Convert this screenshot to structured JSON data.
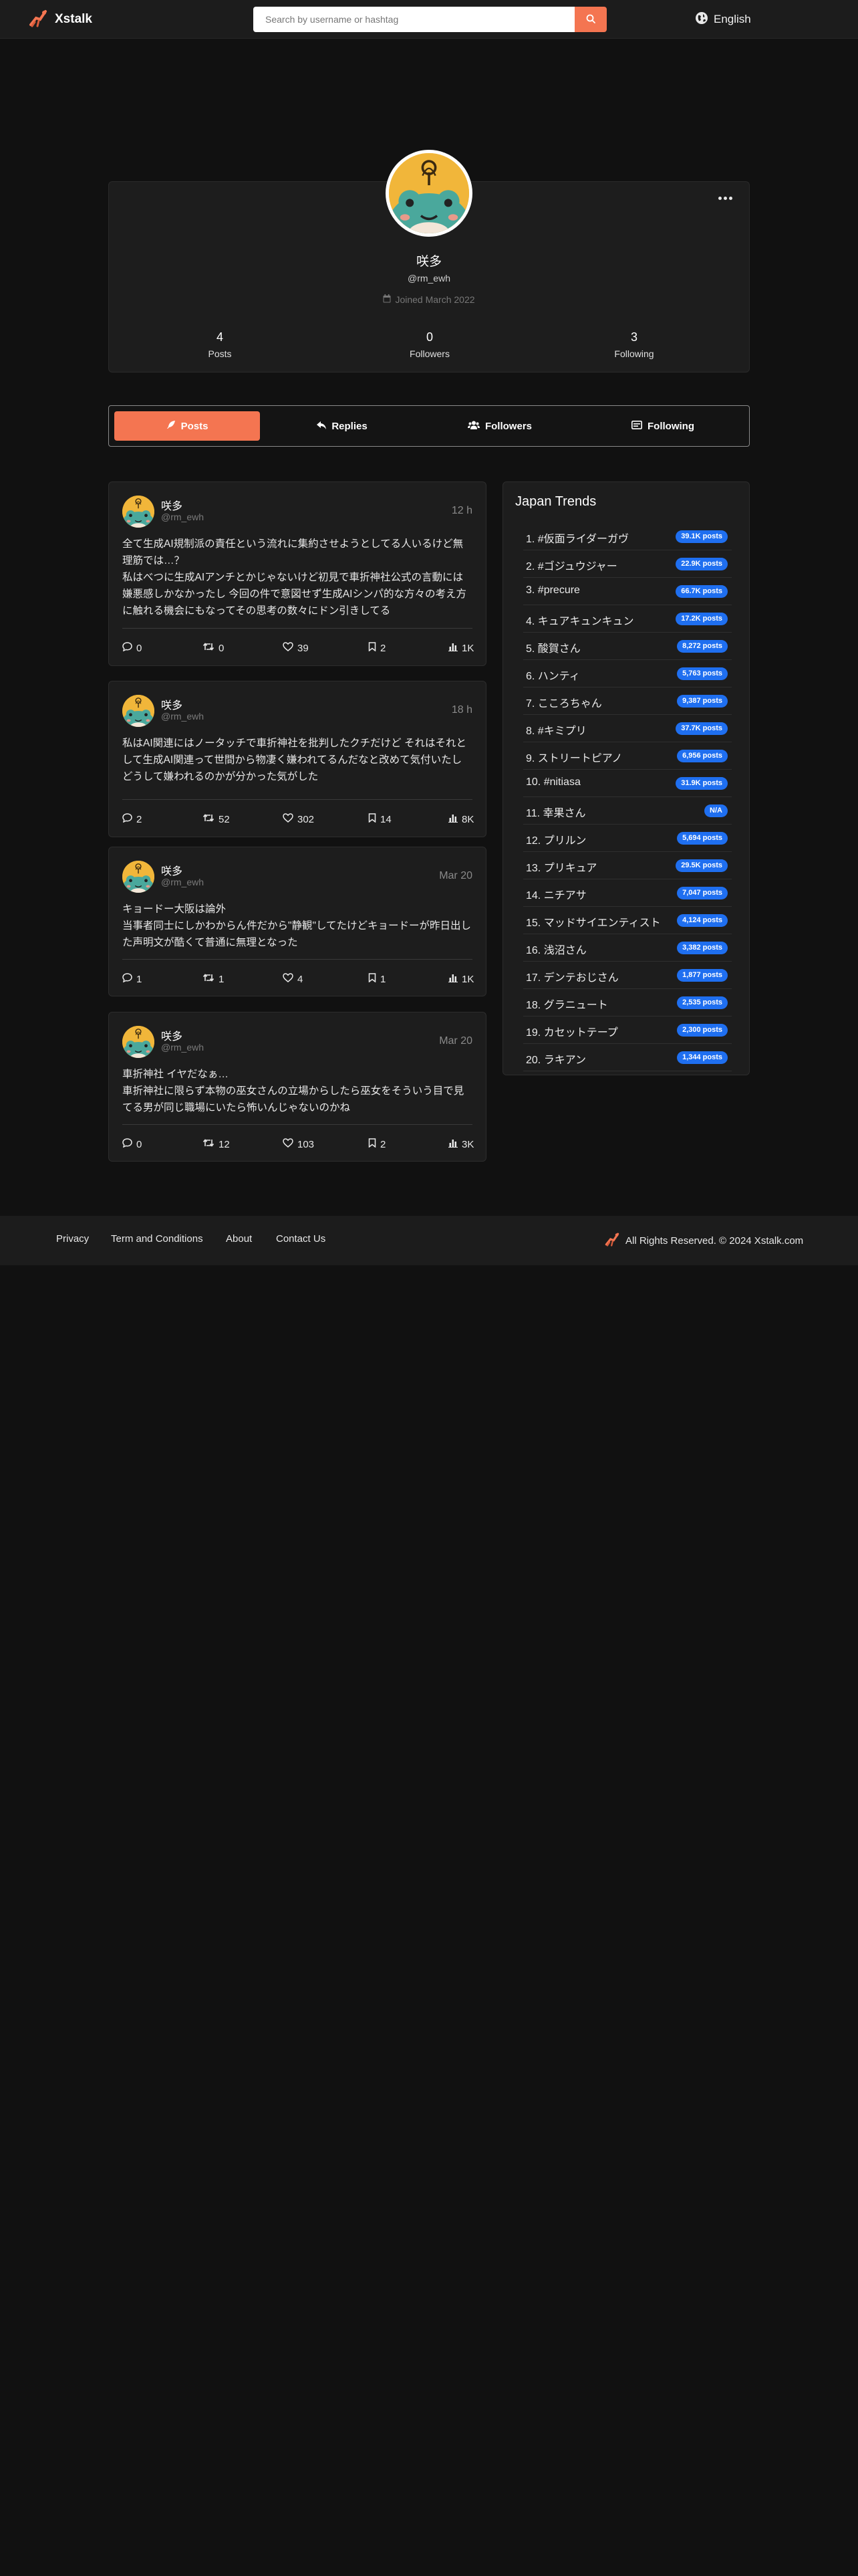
{
  "header": {
    "brand": "Xstalk",
    "search_placeholder": "Search by username or hashtag",
    "language": "English",
    "colors": {
      "accent": "#f47551",
      "badge": "#1f6ff0"
    }
  },
  "profile": {
    "name": "咲多",
    "handle": "@rm_ewh",
    "joined": "Joined March 2022",
    "stats": [
      {
        "value": "4",
        "label": "Posts"
      },
      {
        "value": "0",
        "label": "Followers"
      },
      {
        "value": "3",
        "label": "Following"
      }
    ]
  },
  "tabs": [
    {
      "label": "Posts",
      "icon": "feather-icon",
      "active": true
    },
    {
      "label": "Replies",
      "icon": "reply-icon",
      "active": false
    },
    {
      "label": "Followers",
      "icon": "users-icon",
      "active": false
    },
    {
      "label": "Following",
      "icon": "list-icon",
      "active": false
    }
  ],
  "posts": [
    {
      "name": "咲多",
      "handle": "@rm_ewh",
      "time": "12 h",
      "text": "全て生成AI規制派の責任という流れに集約させようとしてる人いるけど無理筋では…？\n私はべつに生成AIアンチとかじゃないけど初見で車折神社公式の言動には嫌悪感しかなかったし 今回の件で意図せず生成AIシンパ的な方々の考え方に触れる機会にもなってその思考の数々にドン引きしてる",
      "replies": "0",
      "reposts": "0",
      "likes": "39",
      "bookmarks": "2",
      "views": "1K"
    },
    {
      "name": "咲多",
      "handle": "@rm_ewh",
      "time": "18 h",
      "text": "私はAI関連にはノータッチで車折神社を批判したクチだけど それはそれとして生成AI関連って世間から物凄く嫌われてるんだなと改めて気付いたし どうして嫌われるのかが分かった気がした",
      "replies": "2",
      "reposts": "52",
      "likes": "302",
      "bookmarks": "14",
      "views": "8K"
    },
    {
      "name": "咲多",
      "handle": "@rm_ewh",
      "time": "Mar 20",
      "text": "キョードー大阪は論外\n当事者同士にしかわからん件だから\"静観\"してたけどキョードーが昨日出した声明文が酷くて普通に無理となった",
      "replies": "1",
      "reposts": "1",
      "likes": "4",
      "bookmarks": "1",
      "views": "1K"
    },
    {
      "name": "咲多",
      "handle": "@rm_ewh",
      "time": "Mar 20",
      "text": "車折神社 イヤだなぁ…\n車折神社に限らず本物の巫女さんの立場からしたら巫女をそういう目で見てる男が同じ職場にいたら怖いんじゃないのかね",
      "replies": "0",
      "reposts": "12",
      "likes": "103",
      "bookmarks": "2",
      "views": "3K"
    }
  ],
  "trends": {
    "title": "Japan Trends",
    "items": [
      {
        "name": "1. #仮面ライダーガヴ",
        "count": "39.1K posts"
      },
      {
        "name": "2. #ゴジュウジャー",
        "count": "22.9K posts"
      },
      {
        "name": "3. #precure",
        "count": "66.7K posts"
      },
      {
        "name": "4. キュアキュンキュン",
        "count": "17.2K posts"
      },
      {
        "name": "5. 酸賀さん",
        "count": "8,272 posts"
      },
      {
        "name": "6. ハンティ",
        "count": "5,763 posts"
      },
      {
        "name": "7. こころちゃん",
        "count": "9,387 posts"
      },
      {
        "name": "8. #キミプリ",
        "count": "37.7K posts"
      },
      {
        "name": "9. ストリートピアノ",
        "count": "6,956 posts"
      },
      {
        "name": "10. #nitiasa",
        "count": "31.9K posts"
      },
      {
        "name": "11. 幸果さん",
        "count": "N/A"
      },
      {
        "name": "12. プリルン",
        "count": "5,694 posts"
      },
      {
        "name": "13. プリキュア",
        "count": "29.5K posts"
      },
      {
        "name": "14. ニチアサ",
        "count": "7,047 posts"
      },
      {
        "name": "15. マッドサイエンティスト",
        "count": "4,124 posts"
      },
      {
        "name": "16. 浅沼さん",
        "count": "3,382 posts"
      },
      {
        "name": "17. デンテおじさん",
        "count": "1,877 posts"
      },
      {
        "name": "18. グラニュート",
        "count": "2,535 posts"
      },
      {
        "name": "19. カセットテープ",
        "count": "2,300 posts"
      },
      {
        "name": "20. ラキアン",
        "count": "1,344 posts"
      }
    ]
  },
  "footer": {
    "links": [
      "Privacy",
      "Term and Conditions",
      "About",
      "Contact Us"
    ],
    "copyright": "All Rights Reserved. © 2024 Xstalk.com"
  }
}
